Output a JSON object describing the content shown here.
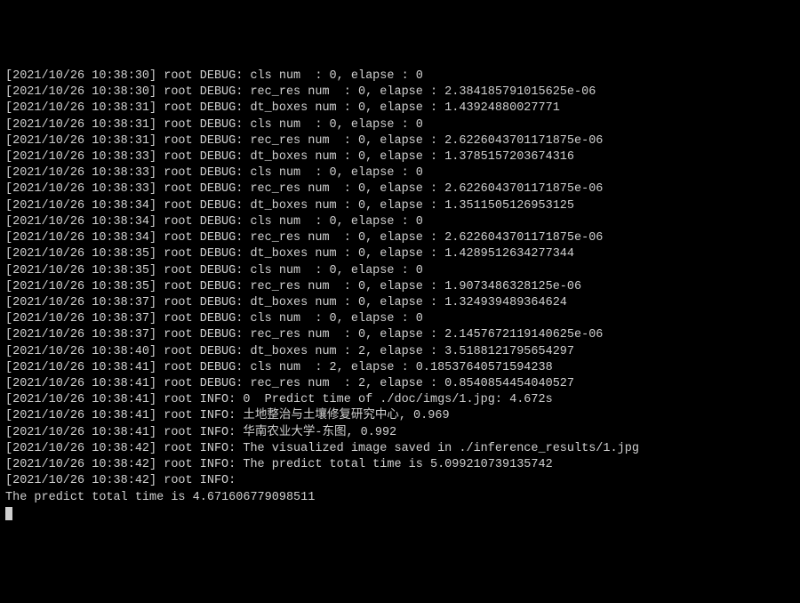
{
  "logs": [
    {
      "timestamp": "2021/10/26 10:38:30",
      "logger": "root",
      "level": "DEBUG",
      "message": "cls num  : 0, elapse : 0"
    },
    {
      "timestamp": "2021/10/26 10:38:30",
      "logger": "root",
      "level": "DEBUG",
      "message": "rec_res num  : 0, elapse : 2.384185791015625e-06"
    },
    {
      "timestamp": "2021/10/26 10:38:31",
      "logger": "root",
      "level": "DEBUG",
      "message": "dt_boxes num : 0, elapse : 1.43924880027771"
    },
    {
      "timestamp": "2021/10/26 10:38:31",
      "logger": "root",
      "level": "DEBUG",
      "message": "cls num  : 0, elapse : 0"
    },
    {
      "timestamp": "2021/10/26 10:38:31",
      "logger": "root",
      "level": "DEBUG",
      "message": "rec_res num  : 0, elapse : 2.6226043701171875e-06"
    },
    {
      "timestamp": "2021/10/26 10:38:33",
      "logger": "root",
      "level": "DEBUG",
      "message": "dt_boxes num : 0, elapse : 1.3785157203674316"
    },
    {
      "timestamp": "2021/10/26 10:38:33",
      "logger": "root",
      "level": "DEBUG",
      "message": "cls num  : 0, elapse : 0"
    },
    {
      "timestamp": "2021/10/26 10:38:33",
      "logger": "root",
      "level": "DEBUG",
      "message": "rec_res num  : 0, elapse : 2.6226043701171875e-06"
    },
    {
      "timestamp": "2021/10/26 10:38:34",
      "logger": "root",
      "level": "DEBUG",
      "message": "dt_boxes num : 0, elapse : 1.3511505126953125"
    },
    {
      "timestamp": "2021/10/26 10:38:34",
      "logger": "root",
      "level": "DEBUG",
      "message": "cls num  : 0, elapse : 0"
    },
    {
      "timestamp": "2021/10/26 10:38:34",
      "logger": "root",
      "level": "DEBUG",
      "message": "rec_res num  : 0, elapse : 2.6226043701171875e-06"
    },
    {
      "timestamp": "2021/10/26 10:38:35",
      "logger": "root",
      "level": "DEBUG",
      "message": "dt_boxes num : 0, elapse : 1.4289512634277344"
    },
    {
      "timestamp": "2021/10/26 10:38:35",
      "logger": "root",
      "level": "DEBUG",
      "message": "cls num  : 0, elapse : 0"
    },
    {
      "timestamp": "2021/10/26 10:38:35",
      "logger": "root",
      "level": "DEBUG",
      "message": "rec_res num  : 0, elapse : 1.9073486328125e-06"
    },
    {
      "timestamp": "2021/10/26 10:38:37",
      "logger": "root",
      "level": "DEBUG",
      "message": "dt_boxes num : 0, elapse : 1.324939489364624"
    },
    {
      "timestamp": "2021/10/26 10:38:37",
      "logger": "root",
      "level": "DEBUG",
      "message": "cls num  : 0, elapse : 0"
    },
    {
      "timestamp": "2021/10/26 10:38:37",
      "logger": "root",
      "level": "DEBUG",
      "message": "rec_res num  : 0, elapse : 2.1457672119140625e-06"
    },
    {
      "timestamp": "2021/10/26 10:38:40",
      "logger": "root",
      "level": "DEBUG",
      "message": "dt_boxes num : 2, elapse : 3.5188121795654297"
    },
    {
      "timestamp": "2021/10/26 10:38:41",
      "logger": "root",
      "level": "DEBUG",
      "message": "cls num  : 2, elapse : 0.18537640571594238"
    },
    {
      "timestamp": "2021/10/26 10:38:41",
      "logger": "root",
      "level": "DEBUG",
      "message": "rec_res num  : 2, elapse : 0.8540854454040527"
    },
    {
      "timestamp": "2021/10/26 10:38:41",
      "logger": "root",
      "level": "INFO",
      "message": "0  Predict time of ./doc/imgs/1.jpg: 4.672s"
    },
    {
      "timestamp": "2021/10/26 10:38:41",
      "logger": "root",
      "level": "INFO",
      "message": "土地整治与土壤修复研究中心, 0.969"
    },
    {
      "timestamp": "2021/10/26 10:38:41",
      "logger": "root",
      "level": "INFO",
      "message": "华南农业大学-东图, 0.992"
    },
    {
      "timestamp": "2021/10/26 10:38:42",
      "logger": "root",
      "level": "INFO",
      "message": "The visualized image saved in ./inference_results/1.jpg"
    },
    {
      "timestamp": "2021/10/26 10:38:42",
      "logger": "root",
      "level": "INFO",
      "message": "The predict total time is 5.099210739135742"
    },
    {
      "timestamp": "2021/10/26 10:38:42",
      "logger": "root",
      "level": "INFO",
      "message": ""
    }
  ],
  "summary_line": "The predict total time is 4.671606779098511"
}
